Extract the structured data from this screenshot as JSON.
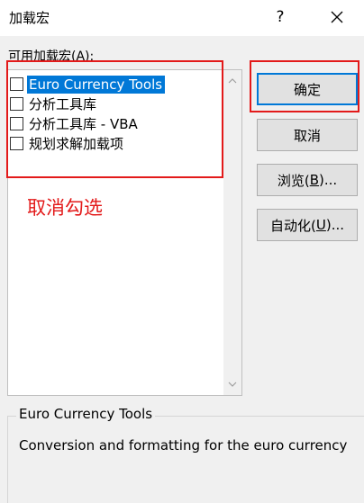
{
  "window": {
    "title": "加载宏",
    "help_label": "?",
    "close_icon": "close-icon"
  },
  "addins_list": {
    "label_prefix": "可用加载宏(",
    "label_key": "A",
    "label_suffix": "):",
    "items": [
      {
        "label": "Euro Currency Tools",
        "checked": false,
        "selected": true
      },
      {
        "label": "分析工具库",
        "checked": false,
        "selected": false
      },
      {
        "label": "分析工具库 - VBA",
        "checked": false,
        "selected": false
      },
      {
        "label": "规划求解加载项",
        "checked": false,
        "selected": false
      }
    ]
  },
  "annotation": {
    "text": "取消勾选",
    "color": "#e31a1a"
  },
  "buttons": {
    "ok": "确定",
    "cancel": "取消",
    "browse_prefix": "浏览(",
    "browse_key": "B",
    "browse_suffix": ")...",
    "automation_prefix": "自动化(",
    "automation_key": "U",
    "automation_suffix": ")..."
  },
  "description": {
    "title": "Euro Currency Tools",
    "text": "Conversion and formatting for the euro currency"
  },
  "colors": {
    "selection": "#0078d7",
    "highlight_box": "#e31a1a"
  }
}
